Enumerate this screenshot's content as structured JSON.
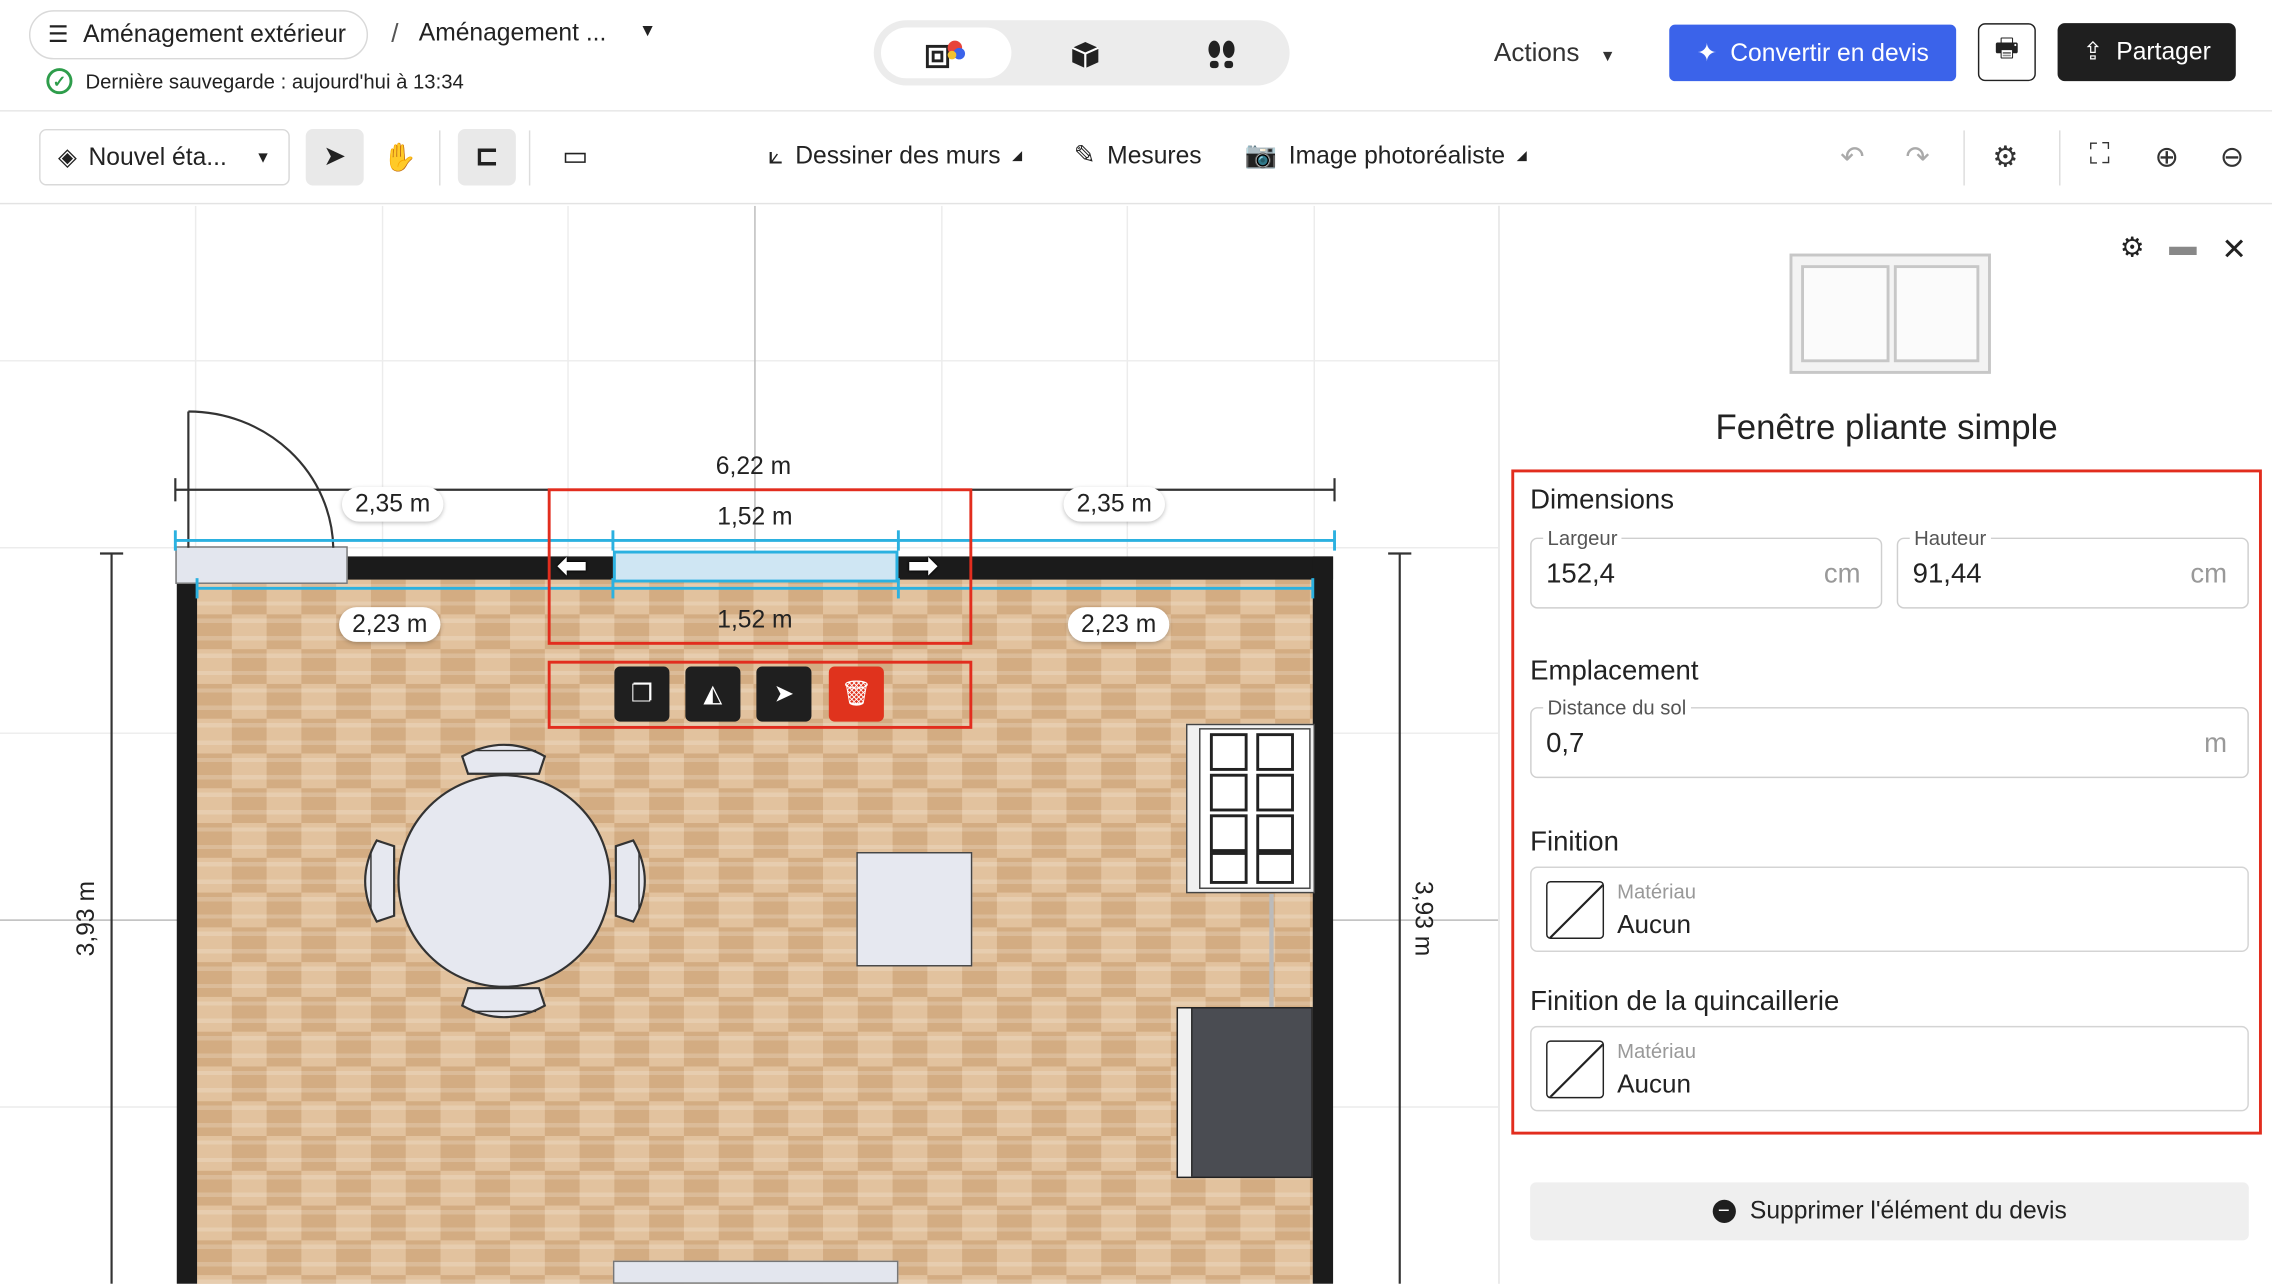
{
  "header": {
    "project_name": "Aménagement extérieur",
    "separator": "/",
    "plan_name": "Aménagement ...",
    "save_status": "Dernière sauvegarde : aujourd'hui à 13:34",
    "actions_label": "Actions",
    "convert_label": "Convertir en devis",
    "share_label": "Partager",
    "accent_color": "#3b63ea"
  },
  "toolbar": {
    "level_label": "Nouvel éta...",
    "draw_walls_label": "Dessiner des murs",
    "measures_label": "Mesures",
    "photo_label": "Image photoréaliste"
  },
  "canvas": {
    "dim_total_width": "6,22 m",
    "dim_left_top": "2,35 m",
    "dim_right_top": "2,35 m",
    "dim_window_top": "1,52 m",
    "dim_window_bottom": "1,52 m",
    "dim_left_inner": "2,23 m",
    "dim_right_inner": "2,23 m",
    "dim_left_height": "3,93 m",
    "dim_right_height": "3,93 m"
  },
  "panel": {
    "title": "Fenêtre pliante simple",
    "dimensions": {
      "heading": "Dimensions",
      "width_label": "Largeur",
      "width_value": "152,4",
      "width_unit": "cm",
      "height_label": "Hauteur",
      "height_value": "91,44",
      "height_unit": "cm"
    },
    "placement": {
      "heading": "Emplacement",
      "floor_label": "Distance du sol",
      "floor_value": "0,7",
      "floor_unit": "m"
    },
    "finish": {
      "heading": "Finition",
      "material_label": "Matériau",
      "material_value": "Aucun"
    },
    "hardware_finish": {
      "heading": "Finition de la quincaillerie",
      "material_label": "Matériau",
      "material_value": "Aucun"
    },
    "remove_label": "Supprimer l'élément du devis"
  }
}
